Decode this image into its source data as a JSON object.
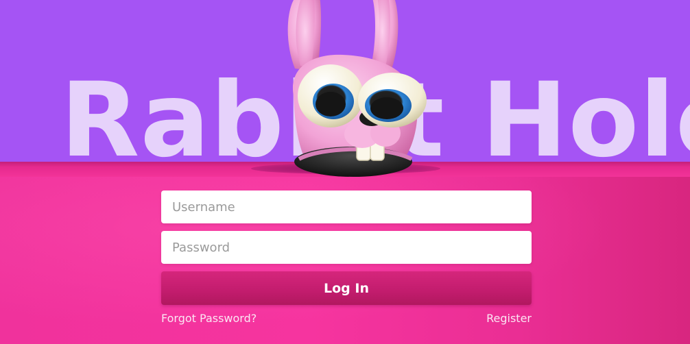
{
  "app": {
    "title_text": "Rabbit Hole"
  },
  "login_form": {
    "username_placeholder": "Username",
    "password_placeholder": "Password",
    "login_label": "Log In",
    "forgot_password_label": "Forgot Password?",
    "register_label": "Register"
  },
  "colors": {
    "sky": "#a554f4",
    "floor": "#f0329c",
    "title_text": "#e6d2fb",
    "login_button": "#c21c6d",
    "bunny": "#f4a6d8"
  },
  "icons": {
    "mascot": "bunny-mascot-icon"
  }
}
